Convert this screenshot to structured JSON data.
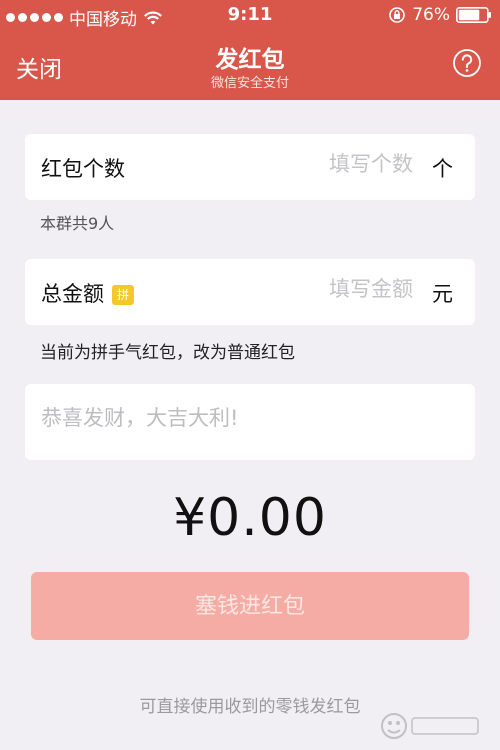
{
  "status_bar": {
    "carrier": "中国移动",
    "time": "9:11",
    "battery": "76%",
    "battery_level": 0.76
  },
  "nav": {
    "close_label": "关闭",
    "title": "发红包",
    "subtitle": "微信安全支付"
  },
  "count_field": {
    "label": "红包个数",
    "placeholder": "填写个数",
    "unit": "个"
  },
  "group_hint": "本群共9人",
  "amount_field": {
    "label": "总金额",
    "badge": "拼",
    "placeholder": "填写金额",
    "unit": "元"
  },
  "type_hint": {
    "current": "当前为拼手气红包，",
    "switch_link": "改为普通红包"
  },
  "greeting": {
    "placeholder": "恭喜发财，大吉大利!"
  },
  "total": "¥0.00",
  "submit_label": "塞钱进红包",
  "footer_note": "可直接使用收到的零钱发红包",
  "colors": {
    "header": "#d9574a",
    "background": "#f1eff3",
    "submit_disabled": "#f5aca4",
    "badge": "#f3c82c"
  },
  "icons": {
    "signal": "signal-dots-icon",
    "wifi": "wifi-icon",
    "rotation_lock": "rotation-lock-icon",
    "battery": "battery-icon",
    "help": "question-circle-icon"
  }
}
